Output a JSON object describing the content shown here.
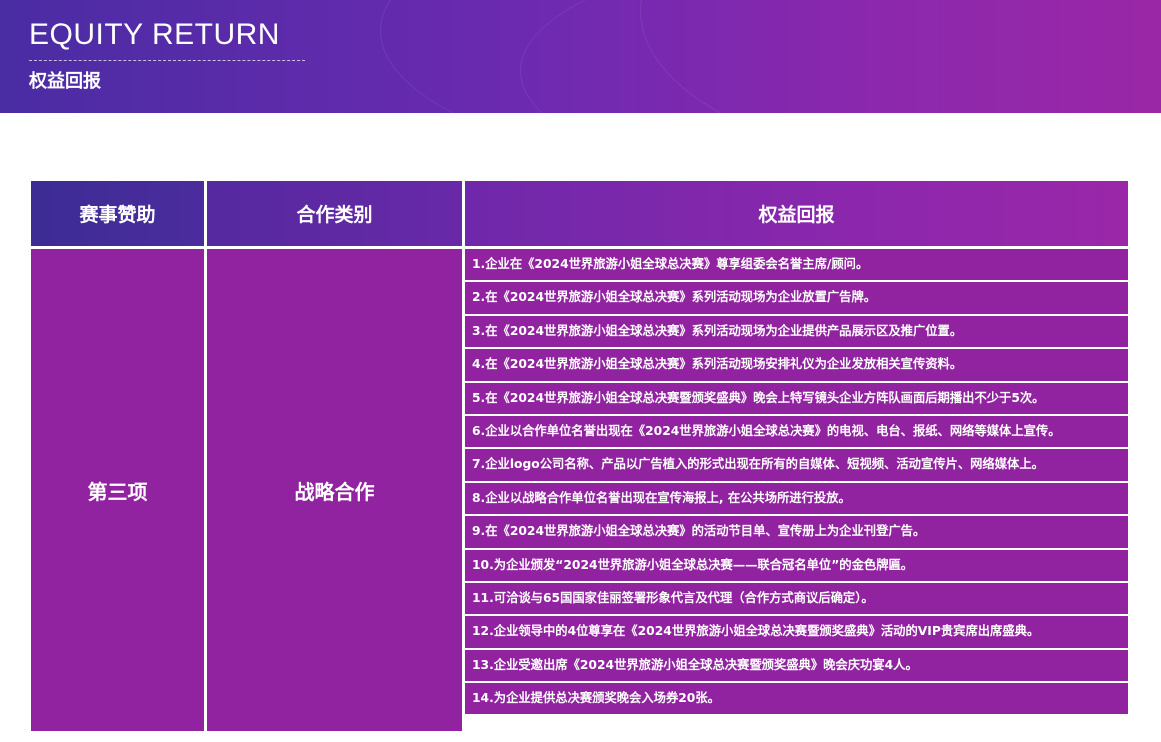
{
  "banner": {
    "title": "EQUITY RETURN",
    "subtitle": "权益回报"
  },
  "table": {
    "headers": [
      "赛事赞助",
      "合作类别",
      "权益回报"
    ],
    "sponsorship": "第三项",
    "category": "战略合作",
    "benefits": [
      "1.企业在《2024世界旅游小姐全球总决赛》尊享组委会名誉主席/顾问。",
      "2.在《2024世界旅游小姐全球总决赛》系列活动现场为企业放置广告牌。",
      "3.在《2024世界旅游小姐全球总决赛》系列活动现场为企业提供产品展示区及推广位置。",
      "4.在《2024世界旅游小姐全球总决赛》系列活动现场安排礼仪为企业发放相关宣传资料。",
      "5.在《2024世界旅游小姐全球总决赛暨颁奖盛典》晚会上特写镜头企业方阵队画面后期播出不少于5次。",
      "6.企业以合作单位名誉出现在《2024世界旅游小姐全球总决赛》的电视、电台、报纸、网络等媒体上宣传。",
      "7.企业logo公司名称、产品以广告植入的形式出现在所有的自媒体、短视频、活动宣传片、网络媒体上。",
      "8.企业以战略合作单位名誉出现在宣传海报上, 在公共场所进行投放。",
      "9.在《2024世界旅游小姐全球总决赛》的活动节目单、宣传册上为企业刊登广告。",
      "10.为企业颁发“2024世界旅游小姐全球总决赛——联合冠名单位”的金色牌匾。",
      "11.可洽谈与65国国家佳丽签署形象代言及代理（合作方式商议后确定）。",
      "12.企业领导中的4位尊享在《2024世界旅游小姐全球总决赛暨颁奖盛典》活动的VIP贵宾席出席盛典。",
      "13.企业受邀出席《2024世界旅游小姐全球总决赛暨颁奖盛典》晚会庆功宴4人。",
      "14.为企业提供总决赛颁奖晚会入场券20张。"
    ]
  }
}
